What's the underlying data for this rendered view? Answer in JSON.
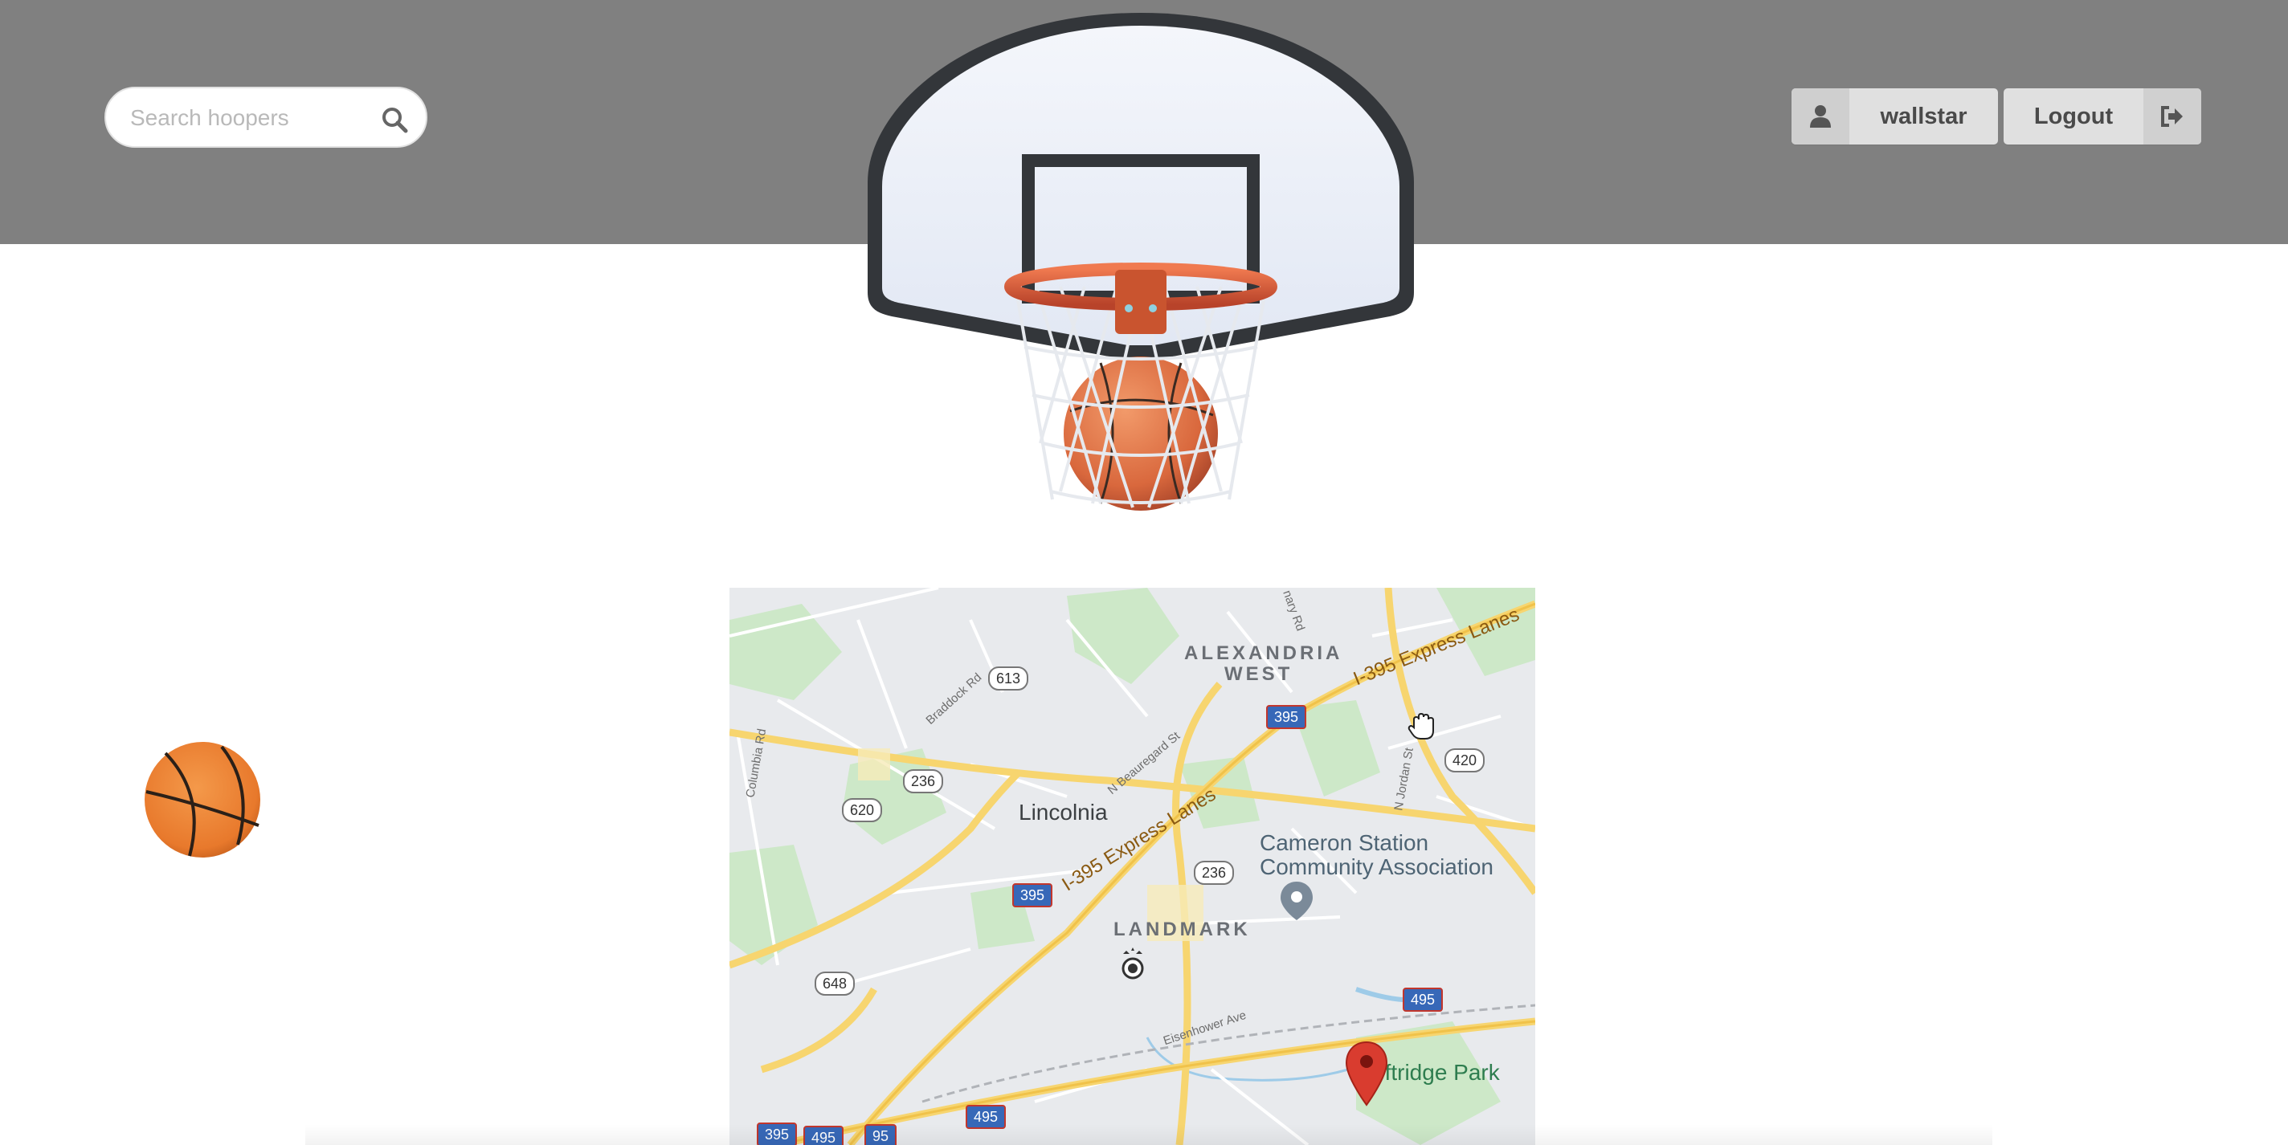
{
  "header": {
    "background": "#808080",
    "search": {
      "placeholder": "Search hoopers",
      "icon": "search-icon"
    },
    "user_button": {
      "label": "wallstar",
      "icon": "user-icon"
    },
    "logout_button": {
      "label": "Logout",
      "icon": "sign-out-icon"
    }
  },
  "hero": {
    "image": "basketball-hoop-with-ball"
  },
  "sidebar": {
    "ball_icon": "basketball-icon"
  },
  "map": {
    "areas": [
      "ALEXANDRIA",
      "WEST",
      "LANDMARK"
    ],
    "places": [
      "Lincolnia"
    ],
    "pois": [
      "Cameron Station",
      "Community Association"
    ],
    "parks": [
      "oftridge Park"
    ],
    "highways": [
      "I-395 Express Lanes",
      "I-395 Express Lanes"
    ],
    "streets": [
      "Braddock Rd",
      "Columbia Rd",
      "N Beauregard St",
      "N Jordan St",
      "Eisenhower Ave",
      "nary Rd"
    ],
    "routes": [
      "613",
      "236",
      "620",
      "236",
      "648",
      "420"
    ],
    "interstates": [
      "395",
      "395",
      "495",
      "495",
      "395",
      "495",
      "95"
    ]
  }
}
